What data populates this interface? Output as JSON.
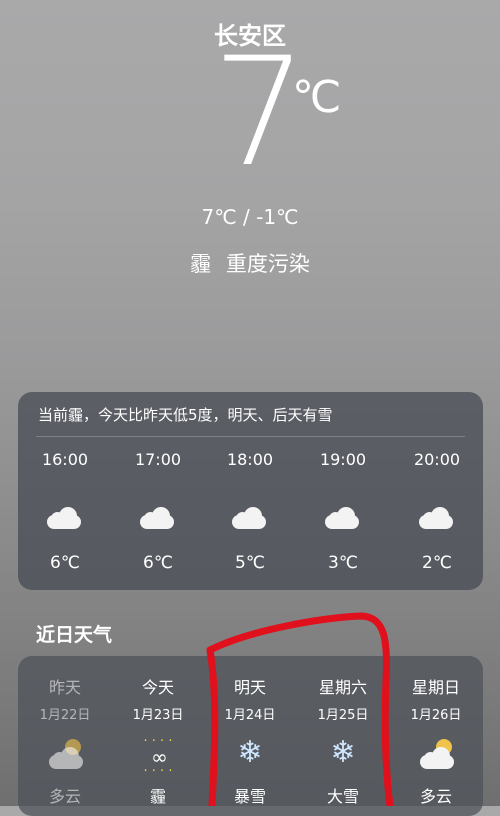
{
  "location": {
    "name": "长安区"
  },
  "current": {
    "temp": "7",
    "unit": "℃",
    "range": "7℃ / -1℃",
    "weather": "霾",
    "pollution": "重度污染"
  },
  "hourly": {
    "summary": "当前霾，今天比昨天低5度，明天、后天有雪",
    "items": [
      {
        "time": "16:00",
        "icon": "cloudy-icon",
        "temp": "6℃"
      },
      {
        "time": "17:00",
        "icon": "cloudy-icon",
        "temp": "6℃"
      },
      {
        "time": "18:00",
        "icon": "cloudy-icon",
        "temp": "5℃"
      },
      {
        "time": "19:00",
        "icon": "cloudy-icon",
        "temp": "3℃"
      },
      {
        "time": "20:00",
        "icon": "cloudy-icon",
        "temp": "2℃"
      }
    ]
  },
  "daily": {
    "title": "近日天气",
    "items": [
      {
        "day": "昨天",
        "date": "1月22日",
        "icon": "partly-cloudy-icon",
        "desc": "多云"
      },
      {
        "day": "今天",
        "date": "1月23日",
        "icon": "haze-icon",
        "desc": "霾"
      },
      {
        "day": "明天",
        "date": "1月24日",
        "icon": "snow-icon",
        "desc": "暴雪"
      },
      {
        "day": "星期六",
        "date": "1月25日",
        "icon": "snow-icon",
        "desc": "大雪"
      },
      {
        "day": "星期日",
        "date": "1月26日",
        "icon": "partly-cloudy-icon",
        "desc": "多云"
      }
    ]
  },
  "colors": {
    "annotation": "#e0101c",
    "snow_icon": "#cfe8ff",
    "sun": "#f0c34a"
  }
}
